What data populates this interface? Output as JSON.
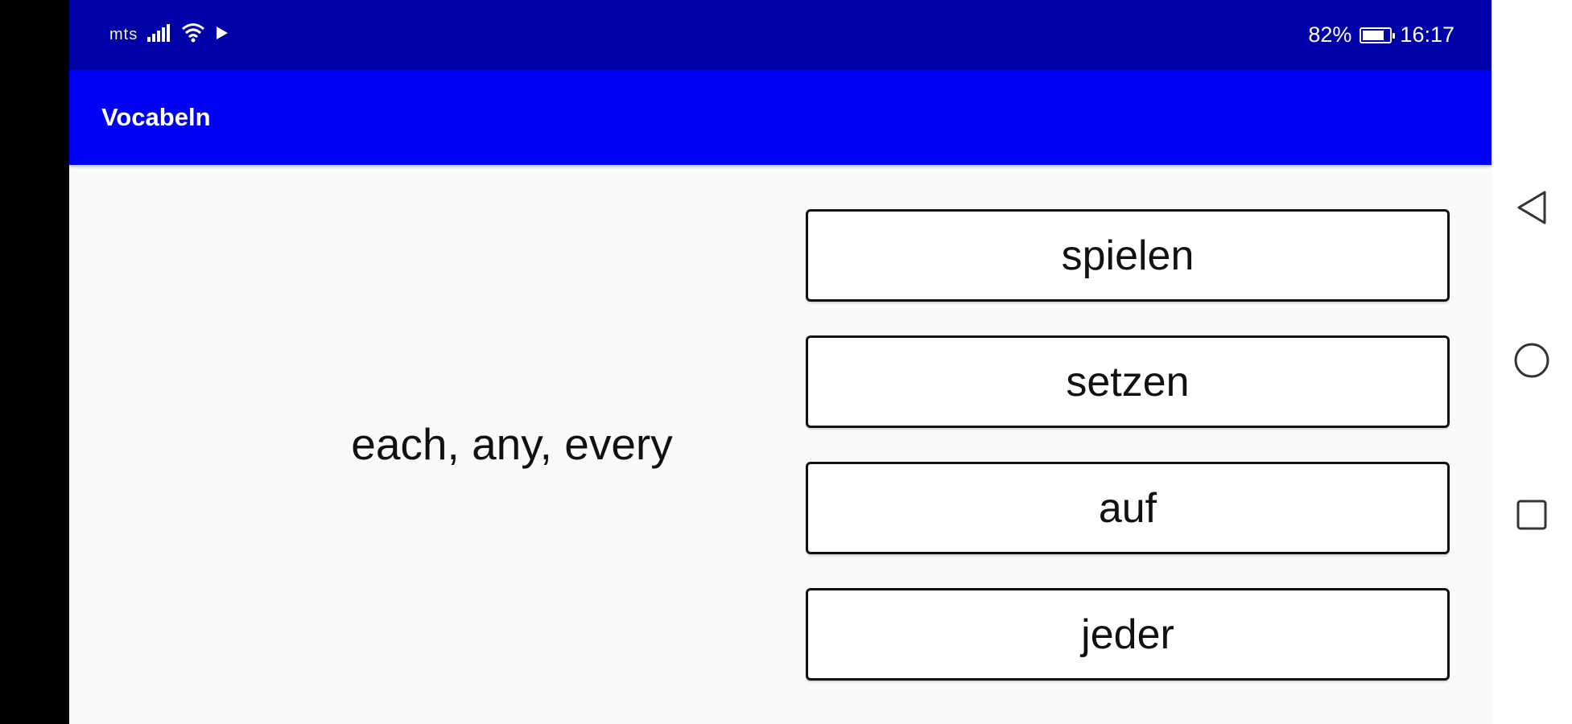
{
  "status_bar": {
    "carrier": "mts",
    "battery_text": "82%",
    "battery_level": 0.82,
    "time": "16:17",
    "icons": [
      "signal-icon",
      "wifi-icon",
      "play-icon",
      "battery-icon"
    ]
  },
  "app_bar": {
    "title": "Vocabeln"
  },
  "quiz": {
    "prompt": "each, any, every",
    "options": [
      {
        "label": "spielen"
      },
      {
        "label": "setzen"
      },
      {
        "label": "auf"
      },
      {
        "label": "jeder"
      }
    ]
  },
  "nav_bar": {
    "buttons": [
      "back-icon",
      "home-icon",
      "recents-icon"
    ]
  },
  "colors": {
    "status_bar": "#0000a8",
    "app_bar": "#0000f5",
    "background": "#fafafa",
    "text": "#111111"
  }
}
